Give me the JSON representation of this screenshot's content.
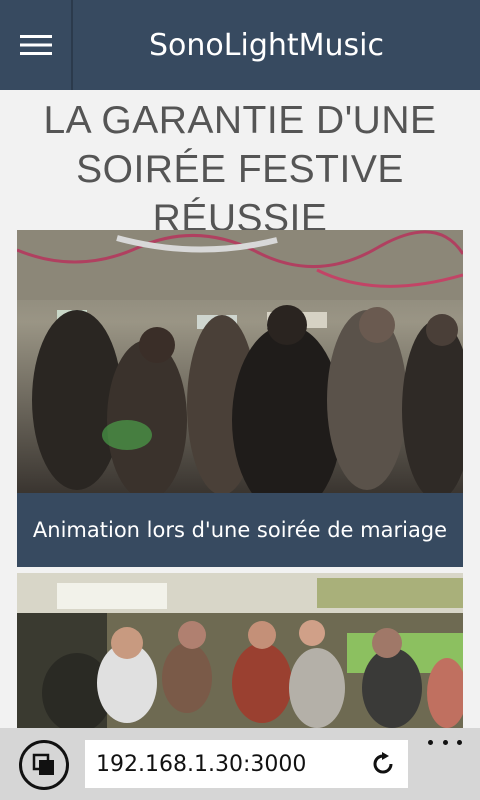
{
  "header": {
    "title": "SonoLightMusic",
    "menu_icon": "hamburger-menu-icon"
  },
  "main": {
    "headline_line1": "LA GARANTIE D'UNE",
    "headline_line2": "SOIRÉE FESTIVE RÉUSSIE",
    "cards": [
      {
        "caption": "Animation lors d'une soirée de mariage"
      },
      {
        "caption": ""
      }
    ]
  },
  "browser": {
    "url": "192.168.1.30:3000",
    "tabs_icon": "tabs-icon",
    "refresh_icon": "refresh-icon",
    "more_icon": "more-options-icon"
  },
  "colors": {
    "header_bg": "#374a60",
    "page_bg": "#f2f2f2",
    "caption_bg": "#374a60",
    "browser_bar_bg": "#d6d6d6"
  }
}
